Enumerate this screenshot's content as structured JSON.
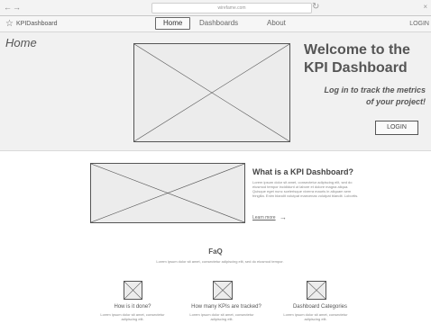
{
  "browser": {
    "back": "←",
    "forward": "→",
    "address": "wirefame.com",
    "reload": "↻",
    "close": "×"
  },
  "topbar": {
    "brand": "KPIDashboard",
    "nav": [
      "Home",
      "Dashboards",
      "About"
    ],
    "login": "LOGIN"
  },
  "hero": {
    "page_title": "Home",
    "welcome": "Welcome to the KPI Dashboard",
    "tagline": "Log in to track the metrics of your project!",
    "login_button": "LOGIN"
  },
  "about": {
    "title": "What is a KPI Dashboard?",
    "body": "Lorem ipsum dolor sit amet, consectetur adipiscing elit, sed do eiusmod tempor incididunt ut labore et dolore magna aliqua. Quisque eget nunc scelerisque viverra mauris in aliquam sem fringilla. Enim blandit volutpat maecenas volutpat blandit. Lobortis.",
    "learn_more": "Learn more",
    "arrow": "→"
  },
  "faq": {
    "title": "FaQ",
    "subtitle": "Lorem ipsum dolor sit amet, consectetur adipiscing elit, sed do eiusmod tempor.",
    "columns": [
      {
        "title": "How is it done?",
        "body": "Lorem ipsum dolor sit amet, consectetur adipiscing elit."
      },
      {
        "title": "How many KPIs are tracked?",
        "body": "Lorem ipsum dolor sit amet, consectetur adipiscing elit."
      },
      {
        "title": "Dashboard Categories",
        "body": "Lorem ipsum dolor sit amet, consectetur adipiscing elit."
      }
    ]
  }
}
